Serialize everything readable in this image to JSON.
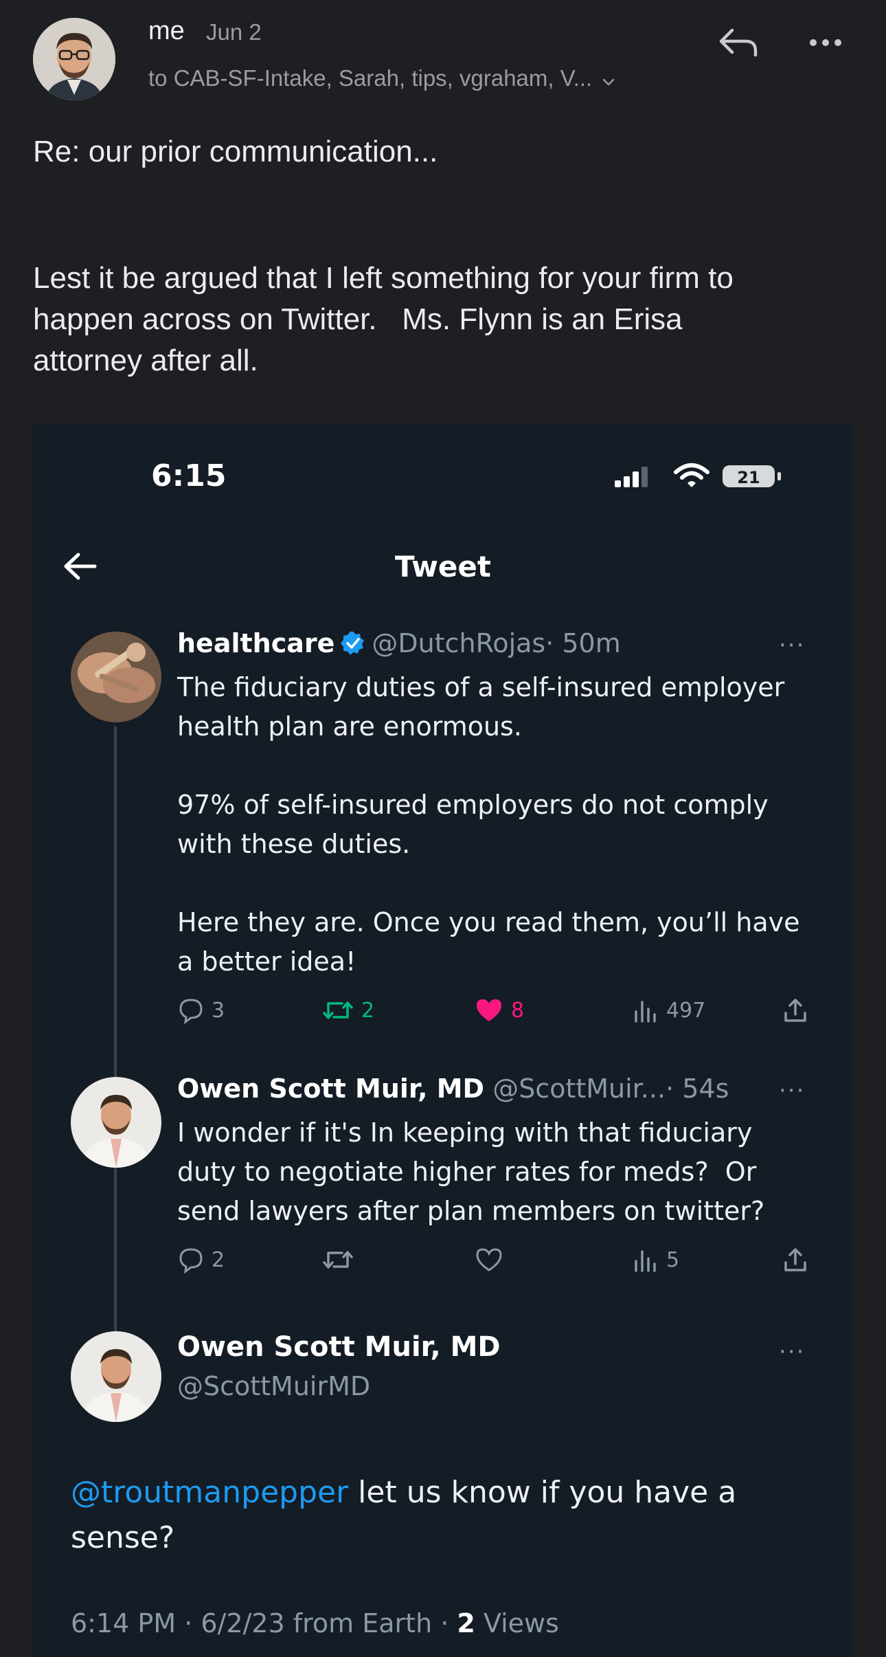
{
  "email": {
    "sender": "me",
    "date": "Jun 2",
    "recipients": "to CAB-SF-Intake, Sarah, tips, vgraham, V...",
    "subject": "Re: our prior communication...",
    "paragraph_line1": "Lest it be argued that I left something for your firm to",
    "paragraph_line2": "happen across on Twitter.   Ms. Flynn is an Erisa",
    "paragraph_line3": "attorney after all."
  },
  "screenshot": {
    "status_time": "6:15",
    "battery": "21",
    "nav_title": "Tweet",
    "tweets": [
      {
        "name": "healthcare",
        "handle": "@DutchRojas",
        "time": "· 50m",
        "more": "···",
        "lines": [
          "The fiduciary duties of a self-insured employer",
          "health plan are enormous.",
          "",
          "97% of self-insured employers do not comply",
          "with these duties.",
          "",
          "Here they are. Once you read them, you’ll have",
          "a better idea!"
        ],
        "replies": "3",
        "retweets": "2",
        "likes": "8",
        "views": "497"
      },
      {
        "name": "Owen Scott Muir, MD",
        "handle": "@ScottMuir...",
        "time": "· 54s",
        "more": "···",
        "lines": [
          "I wonder if it's In keeping with that fiduciary",
          "duty to negotiate higher rates for meds?  Or",
          "send lawyers after plan members on twitter?"
        ],
        "replies": "2",
        "retweets": "",
        "likes": "",
        "views": "5"
      }
    ],
    "main_tweet": {
      "name": "Owen Scott Muir, MD",
      "handle": "@ScottMuirMD",
      "more": "···",
      "mention": "@troutmanpepper",
      "text_after_mention": " let us know if you have a",
      "text_line2": "sense?",
      "meta_prefix": "6:14 PM · 6/2/23 from Earth · ",
      "views_count": "2",
      "views_label": " Views"
    }
  },
  "colors": {
    "email_bg": "#1e1f23",
    "tweet_bg": "#141c25",
    "mention": "#1d9bf0",
    "retweet_active": "#00ba7c",
    "like_active": "#f91880",
    "verified": "#1d9bf0"
  }
}
